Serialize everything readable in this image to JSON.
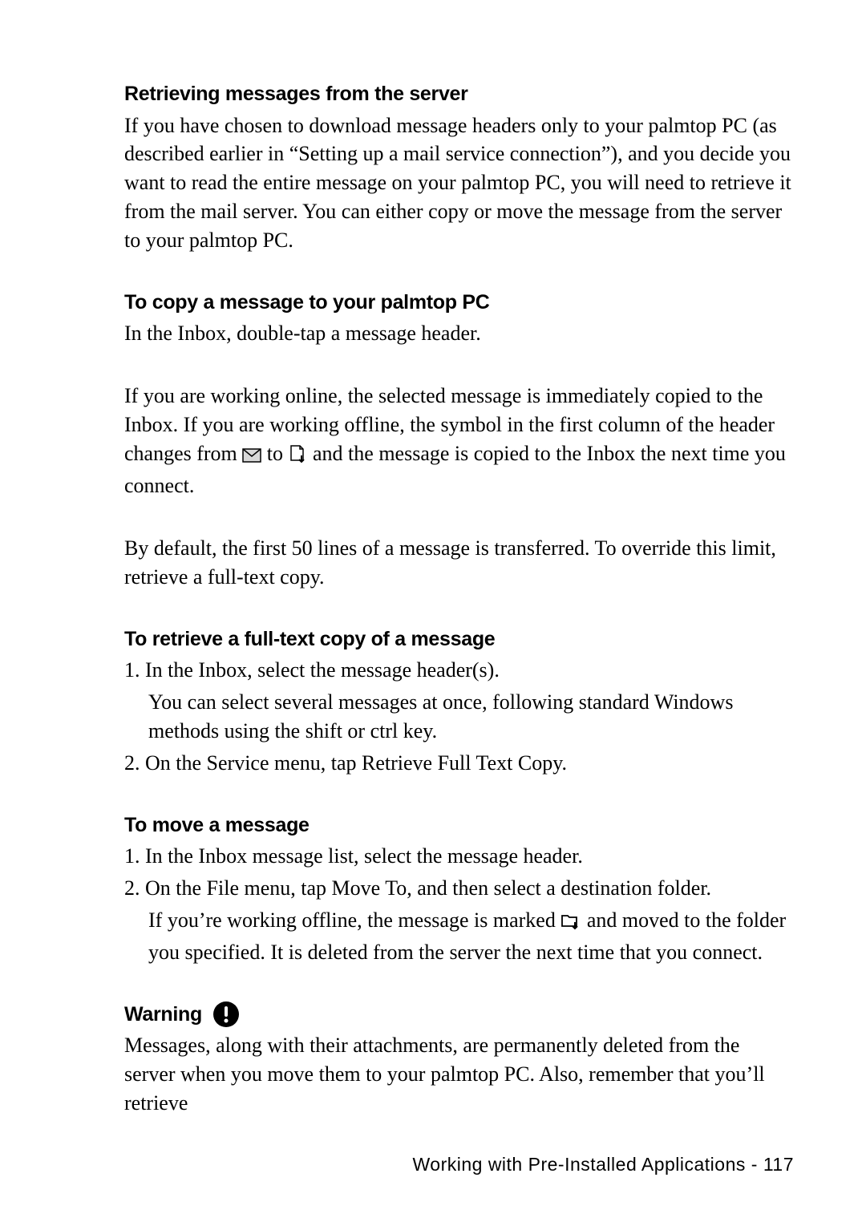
{
  "h1": "Retrieving messages from the server",
  "p1": "If you have chosen to download message headers only to your palmtop PC (as described earlier in “Setting up a mail service connection”), and you decide you want to read the entire message on your palmtop PC, you will need to retrieve it from the mail server. You can either copy or move the message from the server to your palmtop PC.",
  "h2": "To copy a message to your palmtop PC",
  "p2": "In the Inbox, double-tap a message header.",
  "p3a": "If you are working online, the selected message is immediately copied to the Inbox. If you are working offline, the symbol in the first column of the header changes from ",
  "p3b": " to ",
  "p3c": " and the message is copied to the Inbox the next time you connect.",
  "p4": "By default, the first 50 lines of a message is transferred. To override this limit, retrieve a full-text copy.",
  "h3": "To retrieve a full-text copy of a message",
  "s3_1": "1. In the Inbox, select the message header(s).",
  "s3_1b": "You can select several messages at once, following standard Windows methods using the shift or ctrl key.",
  "s3_2": "2. On the Service menu, tap Retrieve Full Text Copy.",
  "h4": "To move a message",
  "s4_1": "1. In the Inbox message list, select the message header.",
  "s4_2": "2. On the File menu, tap Move To, and then select a destination folder.",
  "s4_2b_a": "If you’re working offline, the message is marked ",
  "s4_2b_b": " and moved to the folder you specified. It is deleted from the server the next time that you connect.",
  "h5": "Warning",
  "p5": "Messages, along with their attachments, are permanently deleted from the server when you move them to your palmtop PC. Also, remember that you’ll retrieve",
  "footer_text": "Working with Pre-Installed Applications -",
  "footer_page": "117"
}
